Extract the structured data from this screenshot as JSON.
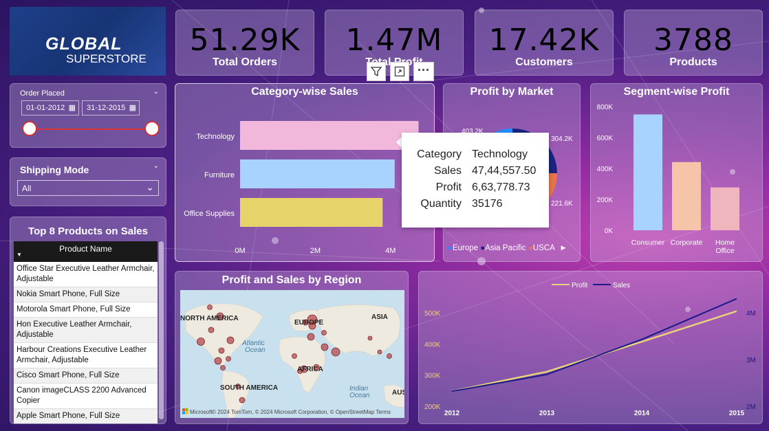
{
  "logo": {
    "brand_top": "GLOBAL",
    "brand_bottom": "SUPERSTORE"
  },
  "kpis": [
    {
      "value": "51.29K",
      "label": "Total Orders"
    },
    {
      "value": "1.47M",
      "label": "Total Profit"
    },
    {
      "value": "17.42K",
      "label": "Customers"
    },
    {
      "value": "3788",
      "label": "Products"
    }
  ],
  "filters": {
    "order_placed": {
      "label": "Order Placed",
      "start": "01-01-2012",
      "end": "31-12-2015"
    },
    "shipping_mode": {
      "label": "Shipping Mode",
      "selected": "All"
    }
  },
  "top_products": {
    "title": "Top 8 Products on Sales",
    "column": "Product Name",
    "items": [
      "Office Star Executive Leather Armchair, Adjustable",
      "Nokia Smart Phone, Full Size",
      "Motorola Smart Phone, Full Size",
      "Hon Executive Leather Armchair, Adjustable",
      "Harbour Creations Executive Leather Armchair, Adjustable",
      "Cisco Smart Phone, Full Size",
      "Canon imageCLASS 2200 Advanced Copier",
      "Apple Smart Phone, Full Size"
    ]
  },
  "visual_toolbar": {
    "filter": "filter-icon",
    "focus": "focus-mode-icon",
    "more": "more-options-icon"
  },
  "category_sales": {
    "title": "Category-wise Sales",
    "ticks": [
      "0M",
      "2M",
      "4M"
    ],
    "chart_data": {
      "type": "bar",
      "orientation": "horizontal",
      "categories": [
        "Technology",
        "Furniture",
        "Office Supplies"
      ],
      "values": [
        4744557.5,
        4110000,
        3790000
      ],
      "xlim": [
        0,
        4900000
      ],
      "colors": [
        "#f1b8dc",
        "#a8d3ff",
        "#e6d36a"
      ]
    }
  },
  "tooltip": {
    "rows": [
      {
        "k": "Category",
        "v": "Technology"
      },
      {
        "k": "Sales",
        "v": "47,44,557.50"
      },
      {
        "k": "Profit",
        "v": "6,63,778.73"
      },
      {
        "k": "Quantity",
        "v": "35176"
      }
    ]
  },
  "profit_market": {
    "title": "Profit by Market",
    "labels": [
      "403.2K",
      "304.2K",
      "221.6K"
    ],
    "legend": [
      {
        "name": "Europe",
        "color": "#1f8fff"
      },
      {
        "name": "Asia Pacific",
        "color": "#1a237e"
      },
      {
        "name": "USCA",
        "color": "#e8744a"
      }
    ]
  },
  "segment_profit": {
    "title": "Segment-wise Profit",
    "chart_data": {
      "type": "bar",
      "categories": [
        "Consumer",
        "Corporate",
        "Home Office"
      ],
      "values": [
        749000,
        441000,
        277000
      ],
      "ticks": [
        "0K",
        "200K",
        "400K",
        "600K",
        "800K"
      ],
      "ylim": [
        0,
        800000
      ],
      "colors": [
        "#a8d3ff",
        "#f6c4a8",
        "#f0b6bd"
      ]
    }
  },
  "region_map": {
    "title": "Profit and Sales by Region",
    "labels": [
      "NORTH AMERICA",
      "EUROPE",
      "ASIA",
      "Atlantic",
      "Ocean",
      "AFRICA",
      "SOUTH AMERICA",
      "Indian",
      "Ocean",
      "AUS"
    ],
    "attribution": "Microsoft",
    "copyright": "© 2024 TomTom, © 2024 Microsoft Corporation, © OpenStreetMap  Terms"
  },
  "trend": {
    "chart_data": {
      "type": "line",
      "x": [
        "2012",
        "2013",
        "2014",
        "2015"
      ],
      "series": [
        {
          "name": "Profit",
          "values": [
            248000,
            311000,
            407000,
            505000
          ],
          "color": "#e8d27a"
        },
        {
          "name": "Sales",
          "values": [
            2.32,
            2.68,
            3.43,
            4.3
          ],
          "color": "#1a1a8a"
        }
      ],
      "y_left_ticks": [
        "200K",
        "300K",
        "400K",
        "500K"
      ],
      "y_right_ticks": [
        "2M",
        "3M",
        "4M"
      ],
      "y_left_range": [
        200000,
        500000
      ],
      "y_right_range": [
        2,
        4
      ]
    }
  }
}
